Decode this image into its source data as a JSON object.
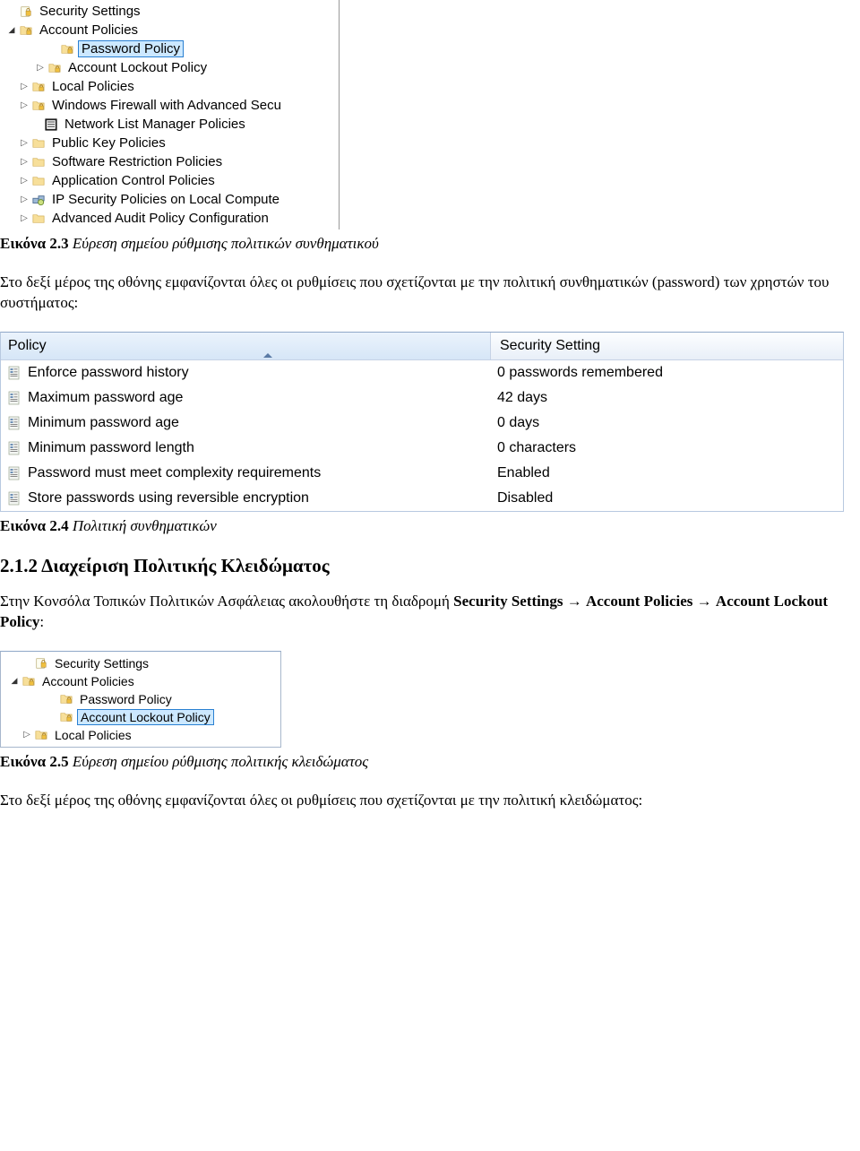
{
  "tree1": {
    "items": [
      {
        "indent": 6,
        "arrow": "",
        "icon": "security",
        "label": "Security Settings",
        "sel": false
      },
      {
        "indent": 6,
        "arrow": "down",
        "icon": "folder-lock",
        "label": "Account Policies",
        "sel": false
      },
      {
        "indent": 52,
        "arrow": "",
        "icon": "folder-lock",
        "label": "Password Policy",
        "sel": true
      },
      {
        "indent": 38,
        "arrow": "right",
        "icon": "folder-lock",
        "label": "Account Lockout Policy",
        "sel": false
      },
      {
        "indent": 20,
        "arrow": "right",
        "icon": "folder-lock",
        "label": "Local Policies",
        "sel": false
      },
      {
        "indent": 20,
        "arrow": "right",
        "icon": "folder-lock",
        "label": "Windows Firewall with Advanced Secu",
        "sel": false
      },
      {
        "indent": 34,
        "arrow": "",
        "icon": "netlist",
        "label": "Network List Manager Policies",
        "sel": false
      },
      {
        "indent": 20,
        "arrow": "right",
        "icon": "folder",
        "label": "Public Key Policies",
        "sel": false
      },
      {
        "indent": 20,
        "arrow": "right",
        "icon": "folder",
        "label": "Software Restriction Policies",
        "sel": false
      },
      {
        "indent": 20,
        "arrow": "right",
        "icon": "folder",
        "label": "Application Control Policies",
        "sel": false
      },
      {
        "indent": 20,
        "arrow": "right",
        "icon": "ipsec",
        "label": "IP Security Policies on Local Compute",
        "sel": false
      },
      {
        "indent": 20,
        "arrow": "right",
        "icon": "folder",
        "label": "Advanced Audit Policy Configuration",
        "sel": false
      }
    ]
  },
  "caption1": {
    "bold": "Εικόνα 2.3",
    "italic": " Εύρεση σημείου ρύθμισης πολιτικών συνθηματικού"
  },
  "para1": "Στο δεξί μέρος της οθόνης εμφανίζονται όλες οι ρυθμίσεις που σχετίζονται με την πολιτική συνθηματικών (password) των χρηστών του συστήματος:",
  "policy_table": {
    "header": {
      "col1": "Policy",
      "col2": "Security Setting"
    },
    "rows": [
      {
        "name": "Enforce password history",
        "value": "0 passwords remembered"
      },
      {
        "name": "Maximum password age",
        "value": "42 days"
      },
      {
        "name": "Minimum password age",
        "value": "0 days"
      },
      {
        "name": "Minimum password length",
        "value": "0 characters"
      },
      {
        "name": "Password must meet complexity requirements",
        "value": "Enabled"
      },
      {
        "name": "Store passwords using reversible encryption",
        "value": "Disabled"
      }
    ]
  },
  "caption2": {
    "bold": "Εικόνα 2.4",
    "italic": " Πολιτική συνθηματικών"
  },
  "section_heading": "2.1.2 Διαχείριση Πολιτικής Κλειδώματος",
  "para2_pre": "Στην Κονσόλα Τοπικών Πολιτικών Ασφάλειας ακολουθήστε τη διαδρομή ",
  "para2_b1": "Security Settings",
  "para2_arrow": " → ",
  "para2_b2": "Account Policies",
  "para2_b3": "Account Lockout Policy",
  "para2_tail": ":",
  "tree2": {
    "items": [
      {
        "indent": 22,
        "arrow": "",
        "icon": "security",
        "label": "Security Settings",
        "sel": false
      },
      {
        "indent": 8,
        "arrow": "down",
        "icon": "folder-lock",
        "label": "Account Policies",
        "sel": false
      },
      {
        "indent": 50,
        "arrow": "",
        "icon": "folder-lock",
        "label": "Password Policy",
        "sel": false
      },
      {
        "indent": 50,
        "arrow": "",
        "icon": "folder-lock",
        "label": "Account Lockout Policy",
        "sel": true
      },
      {
        "indent": 22,
        "arrow": "right",
        "icon": "folder-lock",
        "label": "Local Policies",
        "sel": false
      }
    ]
  },
  "caption3": {
    "bold": "Εικόνα 2.5",
    "italic": " Εύρεση σημείου ρύθμισης πολιτικής κλειδώματος"
  },
  "para3": "Στο δεξί μέρος της οθόνης εμφανίζονται όλες οι ρυθμίσεις που σχετίζονται με την πολιτική κλειδώματος:"
}
